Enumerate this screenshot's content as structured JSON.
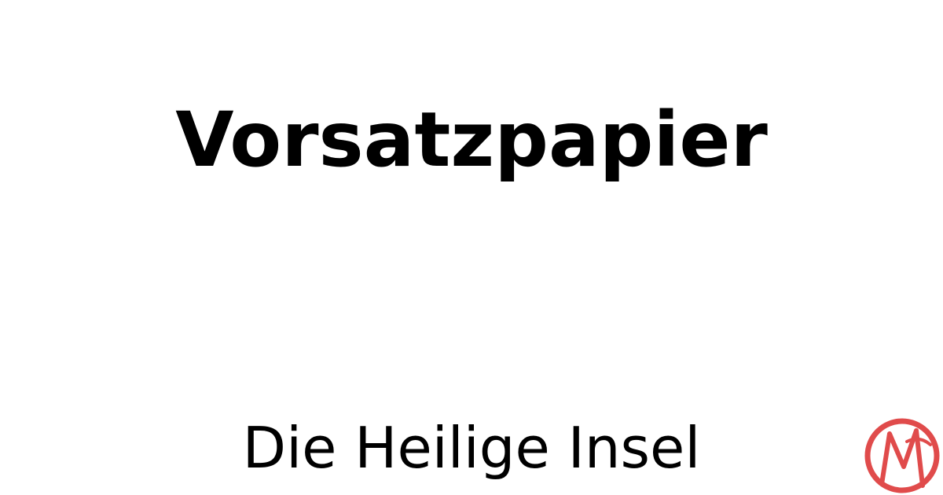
{
  "card": {
    "title": "Vorsatzpapier",
    "subtitle": "Die Heilige Insel",
    "logo_icon": "monogram-cm-logo",
    "logo_color": "#e04b4b",
    "background": "#ffffff",
    "text_color": "#000000"
  }
}
